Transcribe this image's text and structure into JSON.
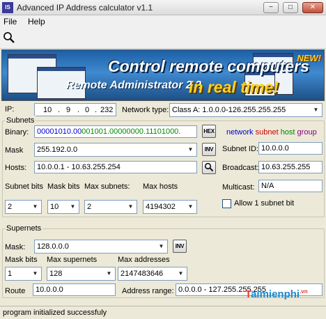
{
  "window": {
    "title": "Advanced IP Address calculator v1.1",
    "app_icon": "IS",
    "btn_minimize": "−",
    "btn_maximize": "□",
    "btn_close": "✕"
  },
  "menu": {
    "file": "File",
    "help": "Help"
  },
  "banner": {
    "headline": "Control remote computers",
    "product": "Remote Administrator 2.2",
    "tagline": "in real time!",
    "badge": "NEW!"
  },
  "ip": {
    "label": "IP:",
    "octets": [
      "10",
      "9",
      "0",
      "232"
    ],
    "dots": [
      ".",
      ".",
      "."
    ],
    "network_type_label": "Network type:",
    "network_type_value": "Class A:   1.0.0.0-126.255.255.255"
  },
  "subnets": {
    "legend": "Subnets",
    "binary_label": "Binary:",
    "binary_parts": [
      "00001010.00",
      "001001.00000000.11101000."
    ],
    "hex_button": "HEX",
    "color_legend": {
      "network": "network",
      "subnet": "subnet",
      "host": "host",
      "group": "group"
    },
    "mask_label": "Mask",
    "mask_value": "255.192.0.0",
    "inv_button": "INV",
    "subnet_id_label": "Subnet ID:",
    "subnet_id_value": "10.0.0.0",
    "hosts_label": "Hosts:",
    "hosts_value": "10.0.0.1 - 10.63.255.254",
    "broadcast_label": "Broadcast:",
    "broadcast_value": "10.63.255.255",
    "multicast_label": "Multicast:",
    "multicast_value": "N/A",
    "subnet_bits_label": "Subnet bits",
    "subnet_bits_value": "2",
    "mask_bits_label": "Mask bits",
    "mask_bits_value": "10",
    "max_subnets_label": "Max subnets:",
    "max_subnets_value": "2",
    "max_hosts_label": "Max hosts",
    "max_hosts_value": "4194302",
    "allow_subnet_label": "Allow 1 subnet bit",
    "allow_subnet_checked": false
  },
  "supernets": {
    "legend": "Supernets",
    "mask_label": "Mask:",
    "mask_value": "128.0.0.0",
    "inv_button": "INV",
    "mask_bits_label": "Mask bits",
    "mask_bits_value": "1",
    "max_supernets_label": "Max supernets",
    "max_supernets_value": "128",
    "max_addresses_label": "Max addresses",
    "max_addresses_value": "2147483646",
    "route_label": "Route",
    "route_value": "10.0.0.0",
    "address_range_label": "Address range:",
    "address_range_value": "0.0.0.0 - 127.255.255.255"
  },
  "status": {
    "text": "program initialized successfuly"
  },
  "watermark": {
    "brand_a": "T",
    "brand_b": "aimienphi",
    "suffix": ".vn"
  },
  "colors": {
    "network": "#0000cc",
    "subnet": "#cc0000",
    "host": "#008800",
    "group": "#880088"
  }
}
